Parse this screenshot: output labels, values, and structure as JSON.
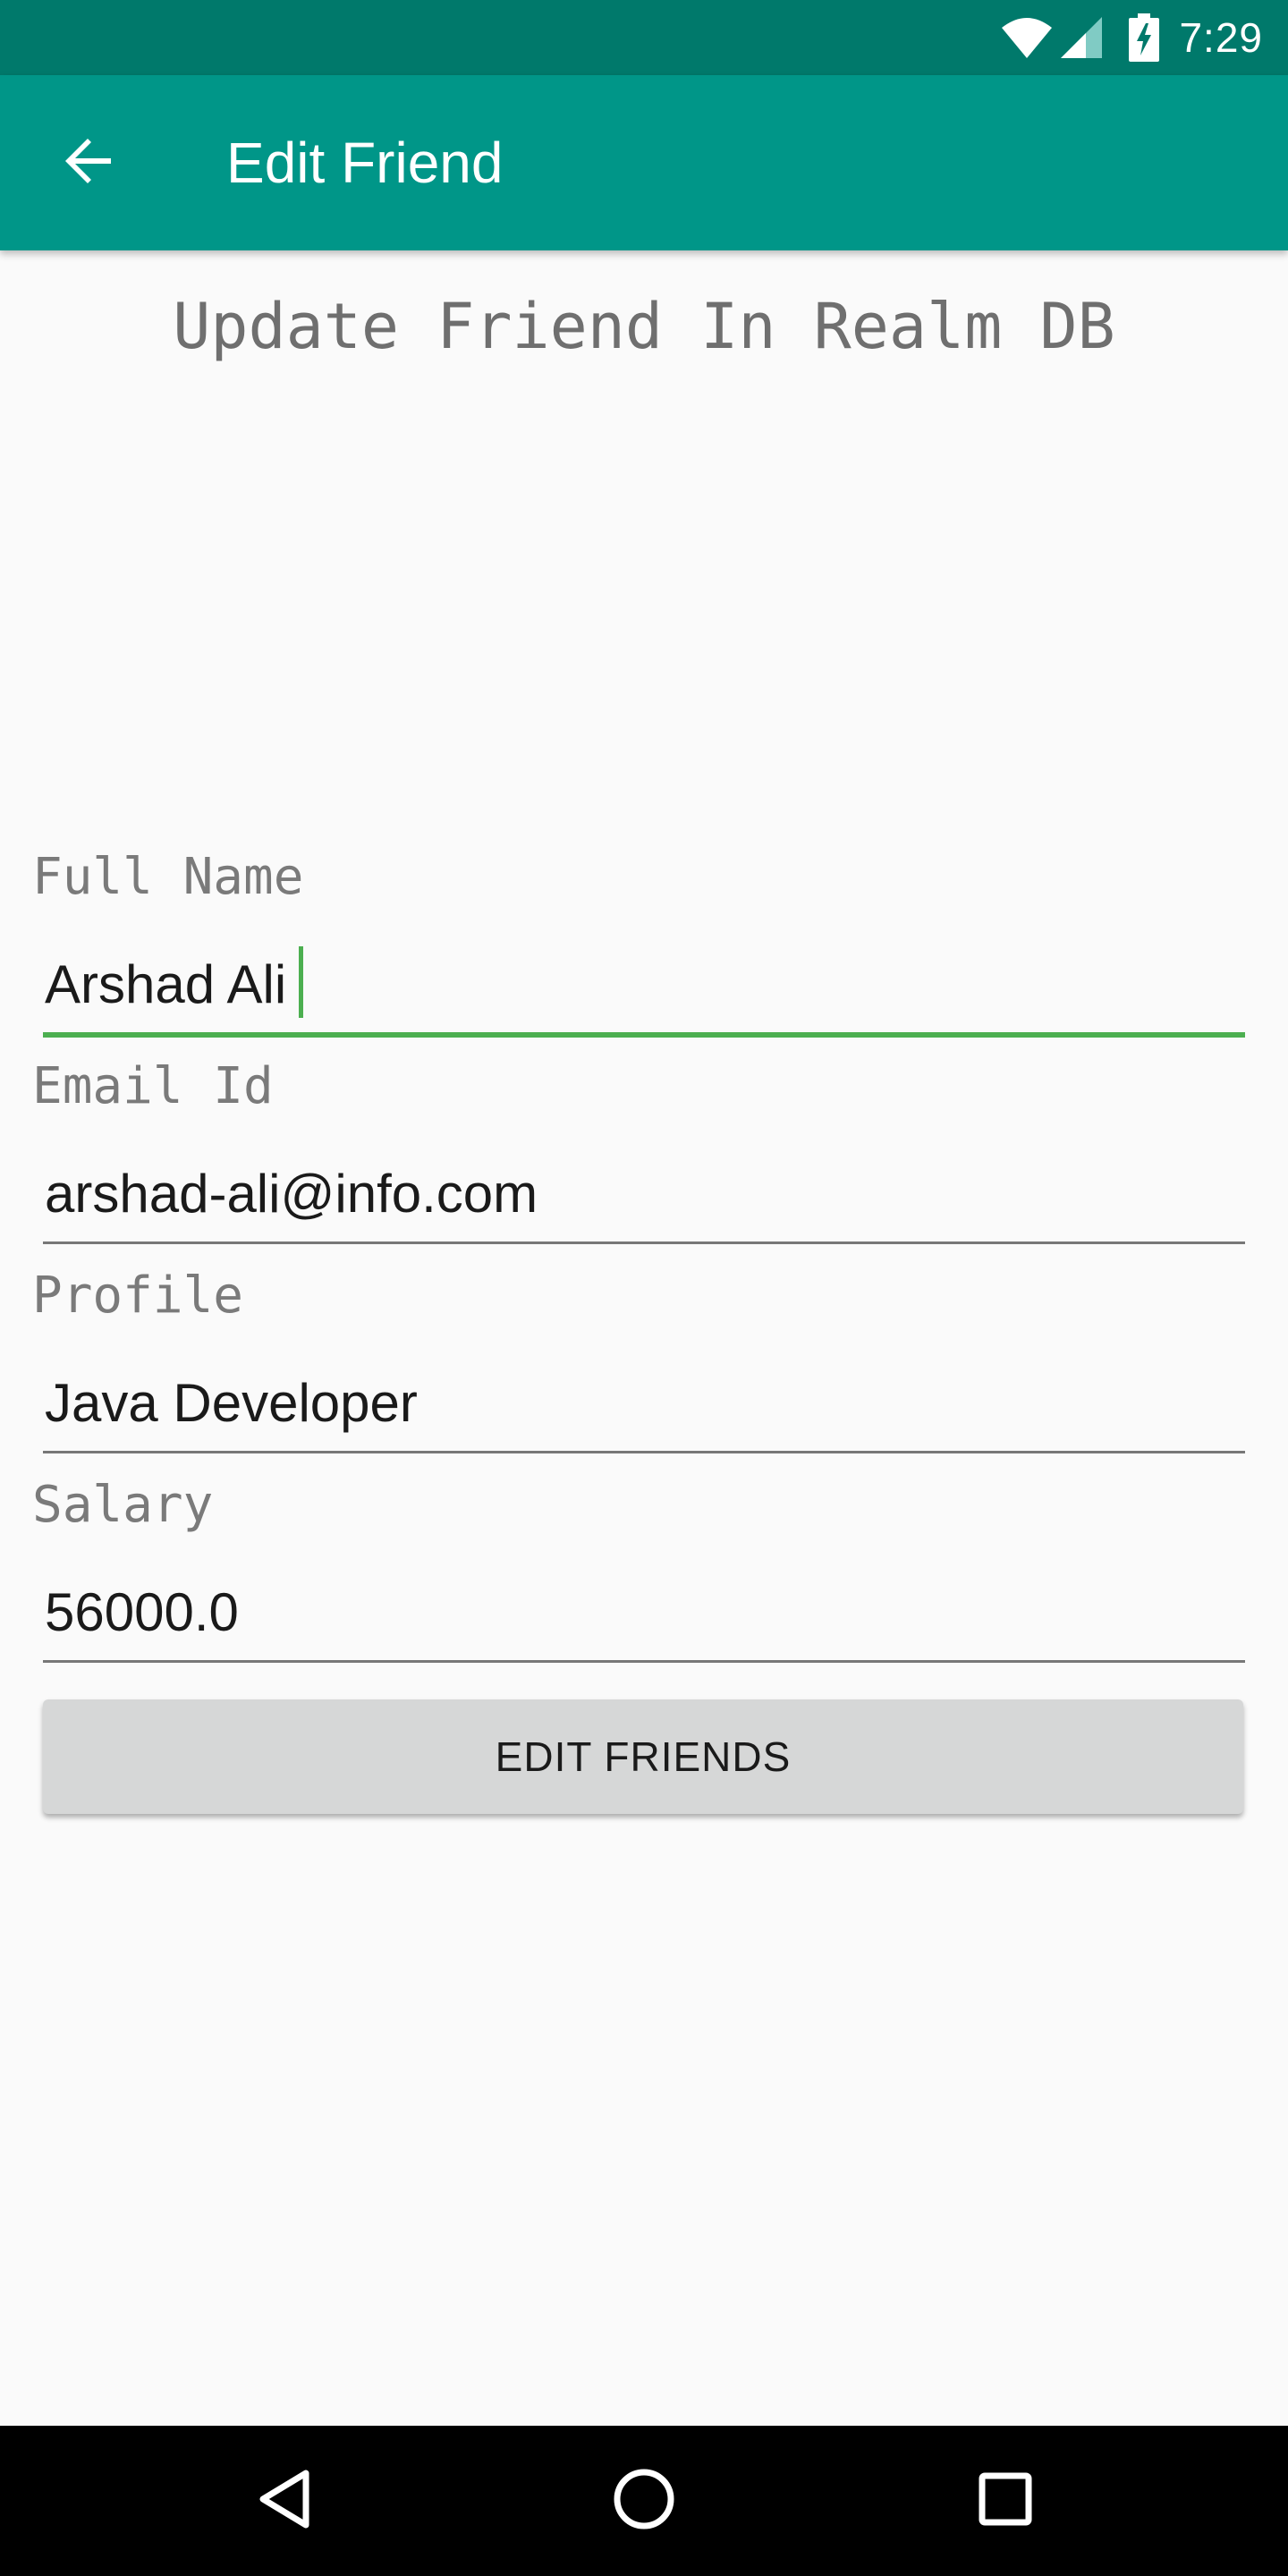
{
  "status_bar": {
    "time": "7:29",
    "icons": [
      "wifi-icon",
      "cellular-signal-icon",
      "battery-charging-icon"
    ]
  },
  "app_bar": {
    "title": "Edit Friend",
    "back_icon": "arrow-back-icon"
  },
  "main": {
    "heading": "Update Friend In Realm DB",
    "fields": [
      {
        "label": "Full Name",
        "value": "Arshad Ali"
      },
      {
        "label": "Email Id",
        "value": "arshad-ali@info.com"
      },
      {
        "label": "Profile",
        "value": "Java Developer"
      },
      {
        "label": "Salary",
        "value": "56000.0"
      }
    ],
    "submit_label": "EDIT FRIENDS"
  },
  "nav_bar": {
    "icons": [
      "back-triangle-icon",
      "home-circle-icon",
      "recents-square-icon"
    ]
  },
  "colors": {
    "status_bar": "#00796b",
    "app_bar": "#009688",
    "focus_accent": "#4caf50",
    "background": "#fafafa",
    "button": "#d6d7d7"
  }
}
